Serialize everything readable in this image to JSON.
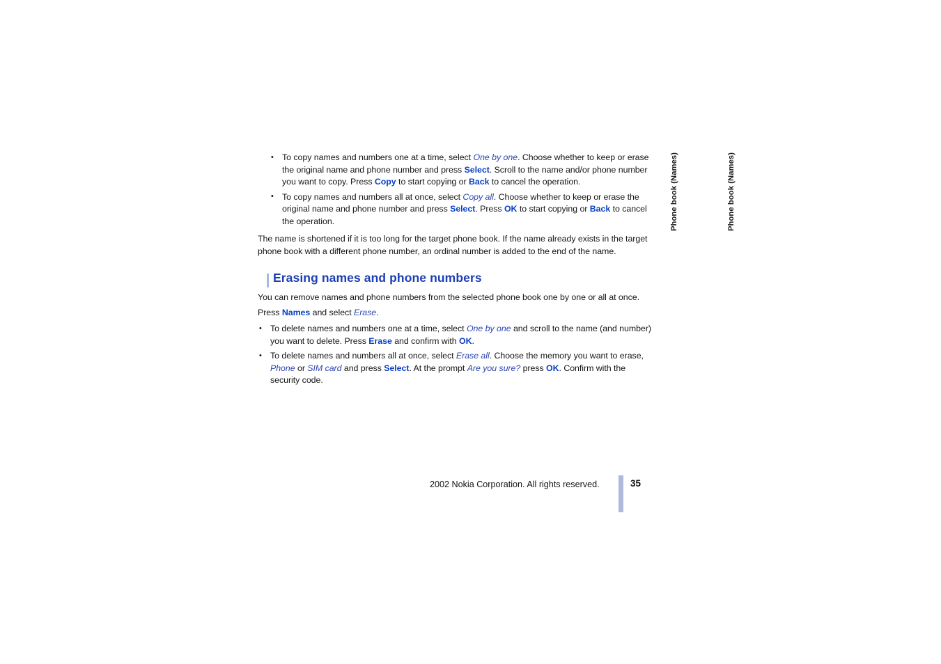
{
  "document": {
    "type": "user-guide-page",
    "page_number": "35",
    "copyright": "2002 Nokia Corporation. All rights reserved.",
    "colors": {
      "heading_blue": "#1d3fb5",
      "softkey_blue": "#0a3fc4",
      "menu_italic_blue": "#2d46ae",
      "rule_lavender": "#aeb9dd",
      "body_black": "#151515"
    }
  },
  "side_tabs": {
    "inner_label": "Phone book (Names)",
    "outer_label": "Phone book (Names)"
  },
  "copy_section": {
    "bullets": [
      {
        "id": "one-by-one",
        "parts": [
          {
            "text": "To copy names and numbers one at a time, select ",
            "style": "plain"
          },
          {
            "text": "One by one",
            "style": "menu"
          },
          {
            "text": ". Choose whether to keep or erase the original name and phone number and press ",
            "style": "plain"
          },
          {
            "text": "Select",
            "style": "cmd"
          },
          {
            "text": ". Scroll to the name and/or phone number you want to copy. Press ",
            "style": "plain"
          },
          {
            "text": "Copy",
            "style": "cmd"
          },
          {
            "text": " to start copying or ",
            "style": "plain"
          },
          {
            "text": "Back",
            "style": "cmd"
          },
          {
            "text": " to cancel the operation.",
            "style": "plain"
          }
        ]
      },
      {
        "id": "copy-all",
        "parts": [
          {
            "text": "To copy names and numbers all at once, select ",
            "style": "plain"
          },
          {
            "text": "Copy all",
            "style": "menu"
          },
          {
            "text": ". Choose whether to keep or erase the original name and phone number and press ",
            "style": "plain"
          },
          {
            "text": "Select",
            "style": "cmd"
          },
          {
            "text": ". Press ",
            "style": "plain"
          },
          {
            "text": "OK",
            "style": "cmd"
          },
          {
            "text": " to start copying or ",
            "style": "plain"
          },
          {
            "text": "Back",
            "style": "cmd"
          },
          {
            "text": " to cancel the operation.",
            "style": "plain"
          }
        ]
      }
    ],
    "note": "The name is shortened if it is too long for the target phone book. If the name already exists in the target phone book with a different phone number, an ordinal number is added to the end of the name."
  },
  "erasing_section": {
    "heading": "Erasing names and phone numbers",
    "intro": "You can remove names and phone numbers from the selected phone book one by one or all at once.",
    "press_line": [
      {
        "text": "Press ",
        "style": "plain"
      },
      {
        "text": "Names",
        "style": "cmd"
      },
      {
        "text": " and select ",
        "style": "plain"
      },
      {
        "text": "Erase",
        "style": "menu"
      },
      {
        "text": ".",
        "style": "plain"
      }
    ],
    "bullets": [
      {
        "id": "delete-one-by-one",
        "parts": [
          {
            "text": "To delete names and numbers one at a time, select ",
            "style": "plain"
          },
          {
            "text": "One by one",
            "style": "menu"
          },
          {
            "text": " and scroll to the name (and number) you want to delete. Press ",
            "style": "plain"
          },
          {
            "text": "Erase",
            "style": "cmd"
          },
          {
            "text": " and confirm with ",
            "style": "plain"
          },
          {
            "text": "OK",
            "style": "cmd"
          },
          {
            "text": ".",
            "style": "plain"
          }
        ]
      },
      {
        "id": "delete-all",
        "parts": [
          {
            "text": "To delete names and numbers all at once, select ",
            "style": "plain"
          },
          {
            "text": "Erase all",
            "style": "menu"
          },
          {
            "text": ". Choose the memory you want to erase, ",
            "style": "plain"
          },
          {
            "text": "Phone",
            "style": "menu"
          },
          {
            "text": " or ",
            "style": "plain"
          },
          {
            "text": "SIM card",
            "style": "menu"
          },
          {
            "text": " and press ",
            "style": "plain"
          },
          {
            "text": "Select",
            "style": "cmd"
          },
          {
            "text": ". At the prompt ",
            "style": "plain"
          },
          {
            "text": "Are you sure?",
            "style": "menu"
          },
          {
            "text": " press ",
            "style": "plain"
          },
          {
            "text": "OK",
            "style": "cmd"
          },
          {
            "text": ". Confirm with the security code.",
            "style": "plain"
          }
        ]
      }
    ]
  }
}
